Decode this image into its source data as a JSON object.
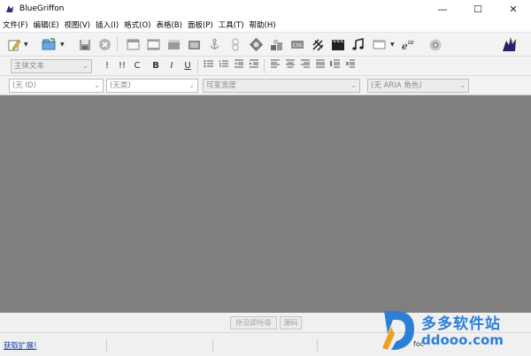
{
  "window": {
    "title": "BlueGriffon",
    "minimize": "—",
    "maximize": "☐",
    "close": "✕"
  },
  "menu": {
    "items": [
      {
        "label": "文件(F)"
      },
      {
        "label": "编辑(E)"
      },
      {
        "label": "视图(V)"
      },
      {
        "label": "插入(I)"
      },
      {
        "label": "格式(O)"
      },
      {
        "label": "表格(B)"
      },
      {
        "label": "面板(P)"
      },
      {
        "label": "工具(T)"
      },
      {
        "label": "帮助(H)"
      }
    ]
  },
  "format_toolbar": {
    "paragraph_format": "主体文本",
    "buttons": [
      "!",
      "!!",
      "C",
      "B",
      "I",
      "U"
    ]
  },
  "attr_toolbar": {
    "id_select": "(无 ID)",
    "class_select": "(无类)",
    "width_select": "可变宽度",
    "aria_select": "(无 ARIA 角色)"
  },
  "modes": {
    "wysiwyg": "所见即所得",
    "source": "源码"
  },
  "status": {
    "link": "获取扩展!",
    "text": "foc"
  },
  "watermark": {
    "name": "多多软件站",
    "url": "ddooo.com"
  },
  "colors": {
    "editor_bg": "#7f7f7f",
    "link": "#1a3ea8",
    "watermark": "#2c7fd6"
  }
}
